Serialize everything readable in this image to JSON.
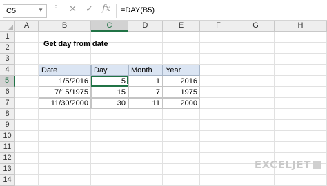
{
  "name_box": {
    "value": "C5"
  },
  "formula_bar": {
    "dots": "⋮",
    "cancel_icon": "✕",
    "enter_icon": "✓",
    "fx_label": "fx",
    "formula": "=DAY(B5)"
  },
  "columns": [
    "A",
    "B",
    "C",
    "D",
    "E",
    "F",
    "G",
    "H"
  ],
  "rows": [
    "1",
    "2",
    "3",
    "4",
    "5",
    "6",
    "7",
    "8",
    "9",
    "10",
    "11",
    "12",
    "13",
    "14"
  ],
  "selected_cell": {
    "column": "C",
    "row": "5"
  },
  "sheet": {
    "title": "Get day from date",
    "table": {
      "headers": [
        "Date",
        "Day",
        "Month",
        "Year"
      ],
      "rows": [
        [
          "1/5/2016",
          "5",
          "1",
          "2016"
        ],
        [
          "7/15/1975",
          "15",
          "7",
          "1975"
        ],
        [
          "11/30/2000",
          "30",
          "11",
          "2000"
        ]
      ]
    }
  },
  "logo": {
    "text": "EXCELJET",
    "icon": "exceljet-logo-icon"
  },
  "colors": {
    "accent": "#217346",
    "header_fill": "#dbe5f3"
  }
}
